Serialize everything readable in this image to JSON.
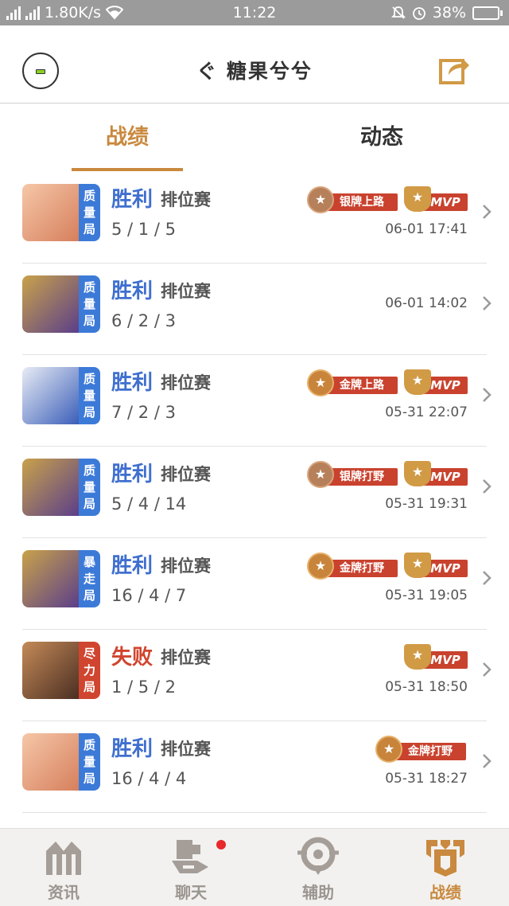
{
  "status_bar": {
    "network_label": "2G",
    "network_label_2": "4G",
    "speed": "1.80K/s",
    "time": "11:22",
    "battery": "38%",
    "battery_level": 0.38
  },
  "header": {
    "title": "ぐ 糖果兮兮"
  },
  "tabs": [
    {
      "label": "战绩",
      "active": true
    },
    {
      "label": "动态",
      "active": false
    }
  ],
  "matches": [
    {
      "tag": [
        "质",
        "量",
        "局"
      ],
      "tag_color": "blue",
      "result": "胜利",
      "outcome": "win",
      "mode": "排位赛",
      "kda": "5 / 1 / 5",
      "rank_badge": "银牌上路",
      "medal": "silver",
      "mvp": "MVP",
      "time": "06-01 17:41",
      "portrait_colors": [
        "#f5c7a8",
        "#d67f5c"
      ]
    },
    {
      "tag": [
        "质",
        "量",
        "局"
      ],
      "tag_color": "blue",
      "result": "胜利",
      "outcome": "win",
      "mode": "排位赛",
      "kda": "6 / 2 / 3",
      "rank_badge": "",
      "medal": "",
      "mvp": "",
      "time": "06-01 14:02",
      "portrait_colors": [
        "#c9a24a",
        "#5a3e8a"
      ]
    },
    {
      "tag": [
        "质",
        "量",
        "局"
      ],
      "tag_color": "blue",
      "result": "胜利",
      "outcome": "win",
      "mode": "排位赛",
      "kda": "7 / 2 / 3",
      "rank_badge": "金牌上路",
      "medal": "gold",
      "mvp": "MVP",
      "time": "05-31 22:07",
      "portrait_colors": [
        "#e8ecf5",
        "#3a5db8"
      ]
    },
    {
      "tag": [
        "质",
        "量",
        "局"
      ],
      "tag_color": "blue",
      "result": "胜利",
      "outcome": "win",
      "mode": "排位赛",
      "kda": "5 / 4 / 14",
      "rank_badge": "银牌打野",
      "medal": "silver",
      "mvp": "MVP",
      "time": "05-31 19:31",
      "portrait_colors": [
        "#c9a24a",
        "#5a3e8a"
      ]
    },
    {
      "tag": [
        "暴",
        "走",
        "局"
      ],
      "tag_color": "blue",
      "result": "胜利",
      "outcome": "win",
      "mode": "排位赛",
      "kda": "16 / 4 / 7",
      "rank_badge": "金牌打野",
      "medal": "gold",
      "mvp": "MVP",
      "time": "05-31 19:05",
      "portrait_colors": [
        "#c9a24a",
        "#5a3e8a"
      ]
    },
    {
      "tag": [
        "尽",
        "力",
        "局"
      ],
      "tag_color": "red",
      "result": "失败",
      "outcome": "lose",
      "mode": "排位赛",
      "kda": "1 / 5 / 2",
      "rank_badge": "",
      "medal": "",
      "mvp": "MVP",
      "time": "05-31 18:50",
      "portrait_colors": [
        "#c48a58",
        "#4a2e22"
      ]
    },
    {
      "tag": [
        "质",
        "量",
        "局"
      ],
      "tag_color": "blue",
      "result": "胜利",
      "outcome": "win",
      "mode": "排位赛",
      "kda": "16 / 4 / 4",
      "rank_badge": "金牌打野",
      "medal": "gold",
      "mvp": "",
      "time": "05-31 18:27",
      "portrait_colors": [
        "#f5c7a8",
        "#d67f5c"
      ]
    }
  ],
  "bottom_nav": [
    {
      "label": "资讯",
      "icon": "news-icon",
      "active": false,
      "dot": false
    },
    {
      "label": "聊天",
      "icon": "chat-icon",
      "active": false,
      "dot": true
    },
    {
      "label": "辅助",
      "icon": "assist-icon",
      "active": false,
      "dot": false
    },
    {
      "label": "战绩",
      "icon": "record-icon",
      "active": true,
      "dot": false
    }
  ],
  "colors": {
    "accent": "#c9893e",
    "win": "#3f6fcf",
    "lose": "#d0452f",
    "ribbon": "#c9422e",
    "status_bar": "#9b9b9b"
  }
}
